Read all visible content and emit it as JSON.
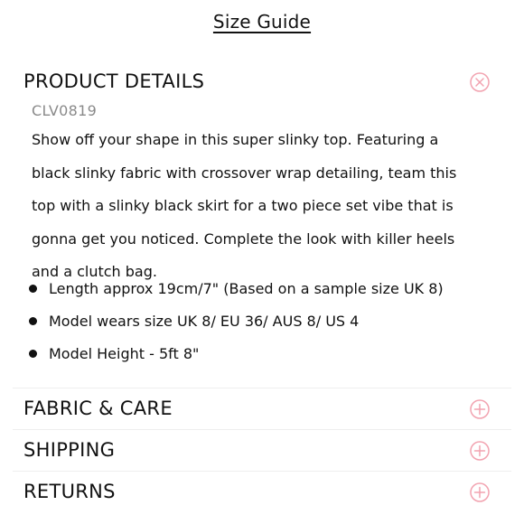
{
  "header": {
    "size_guide_link": "Size Guide"
  },
  "sections": [
    {
      "title": "PRODUCT DETAILS",
      "icon": "close-circle-icon",
      "expanded": true,
      "sku": "CLV0819",
      "description": "Show off your shape in this super slinky top. Featuring a black slinky fabric with crossover wrap detailing, team this top with a slinky black skirt for a two piece set vibe that is gonna get you noticed. Complete the look with killer heels and a clutch bag.",
      "bullets": [
        "Length approx 19cm/7\" (Based on a sample size UK 8)",
        "Model wears size UK 8/ EU 36/ AUS 8/ US 4",
        "Model Height - 5ft 8\""
      ]
    },
    {
      "title": "FABRIC & CARE",
      "icon": "plus-circle-icon",
      "expanded": false
    },
    {
      "title": "SHIPPING",
      "icon": "plus-circle-icon",
      "expanded": false
    },
    {
      "title": "RETURNS",
      "icon": "plus-circle-icon",
      "expanded": false
    }
  ],
  "colors": {
    "text": "#111111",
    "sku": "#8a8a8a",
    "icon_accent": "#f2a3b0",
    "divider": "#eeeeee",
    "background": "#ffffff"
  }
}
